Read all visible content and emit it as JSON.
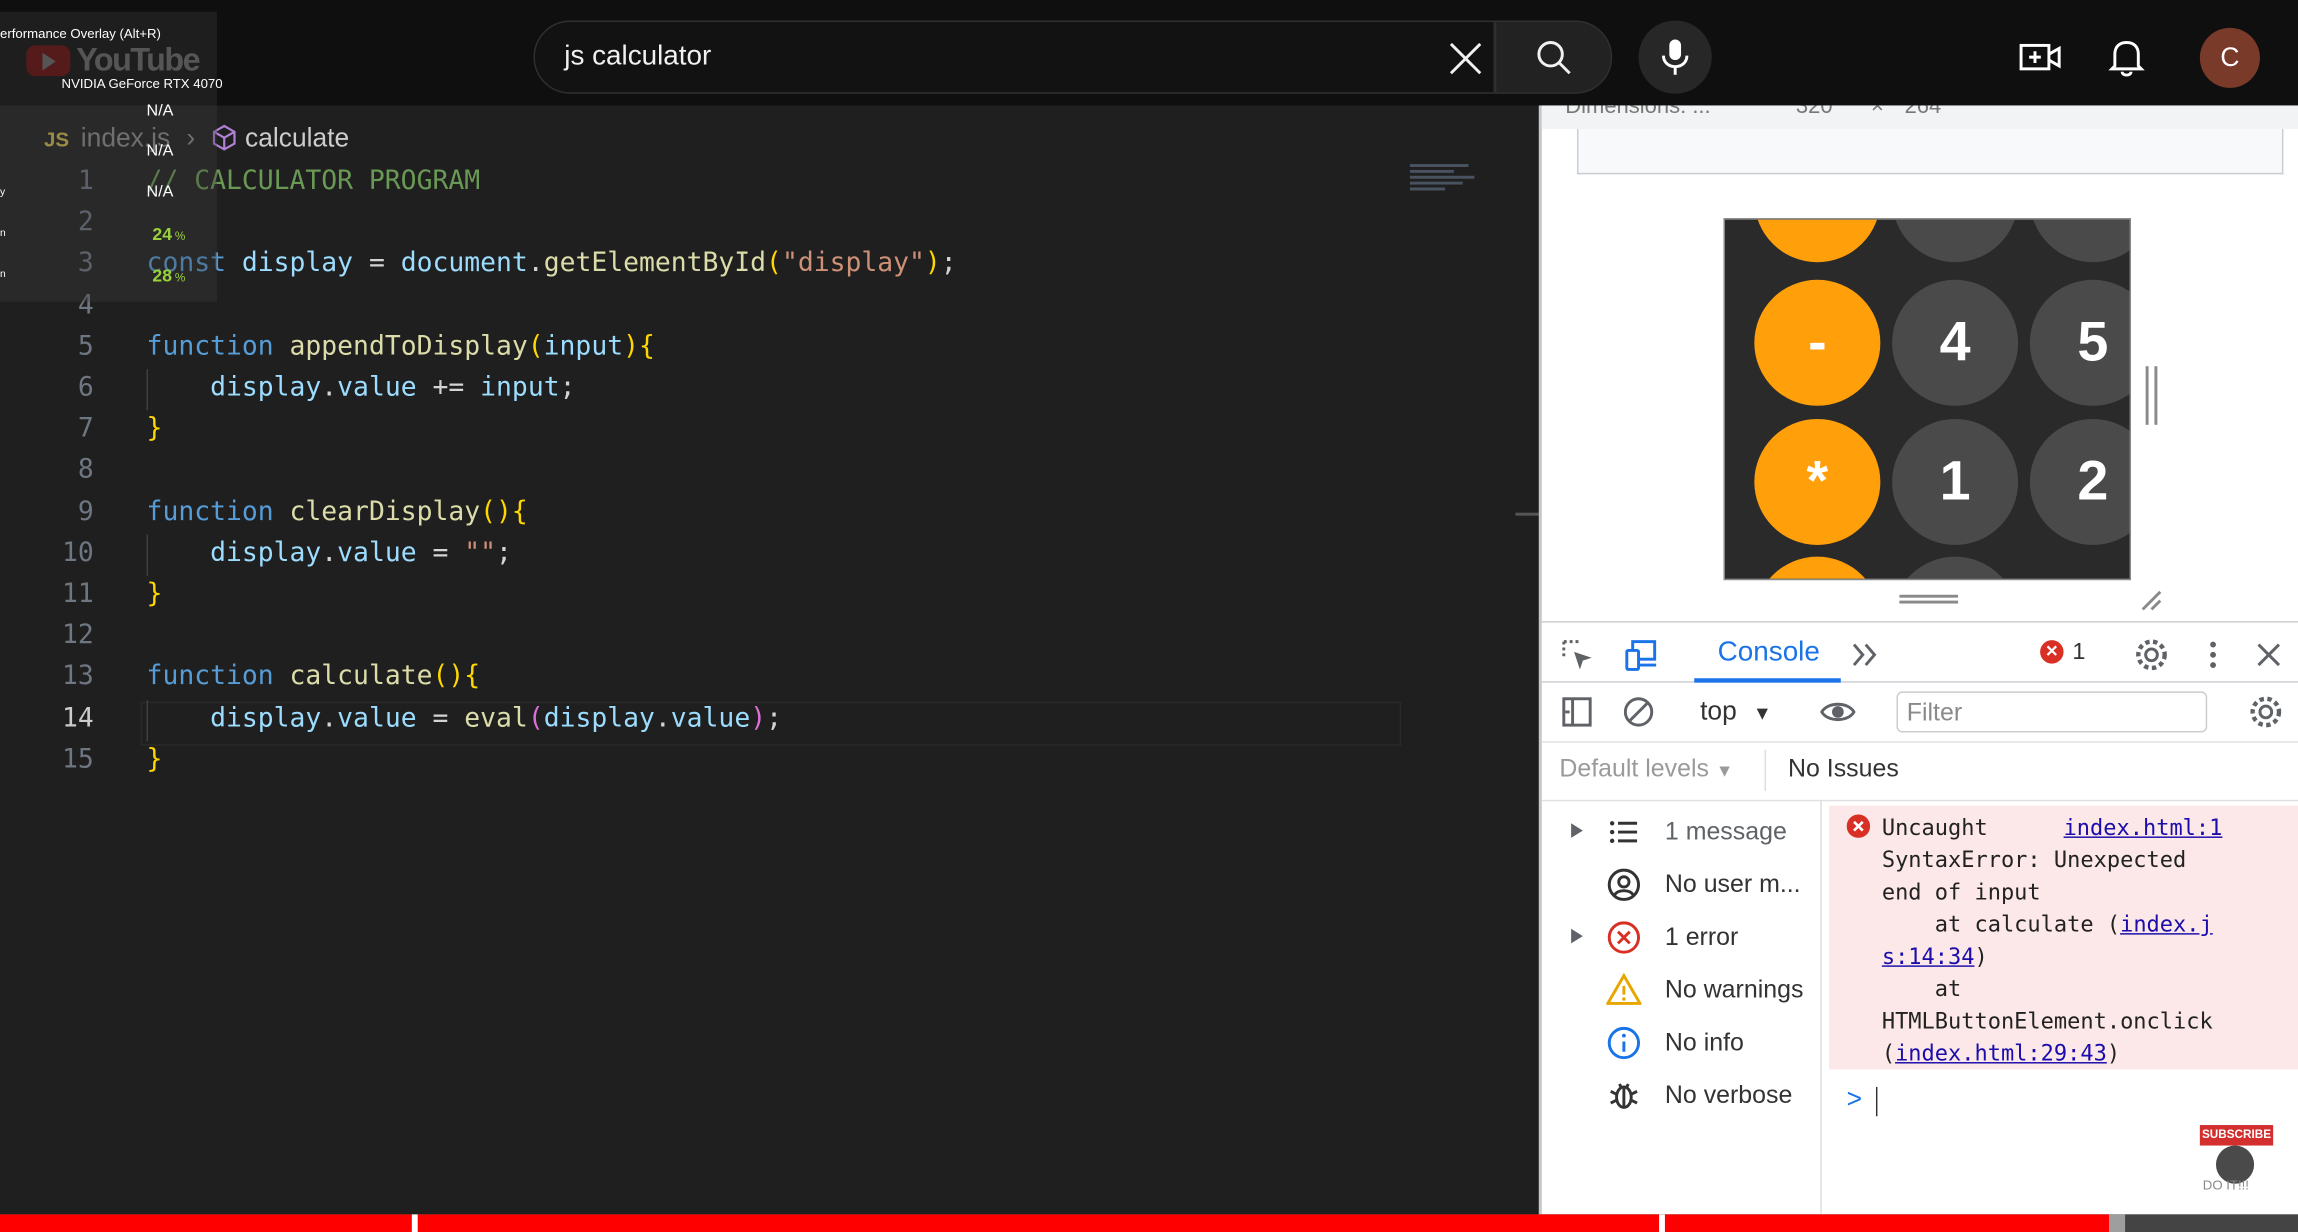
{
  "overlay": {
    "title": "erformance Overlay (Alt+R)",
    "gpu": "NVIDIA GeForce RTX 4070",
    "values": [
      "N/A",
      "N/A",
      "N/A"
    ],
    "percents": [
      "24",
      "28"
    ],
    "unit": "%",
    "side": [
      "y",
      "n",
      "n"
    ]
  },
  "youtube": {
    "logo": "YouTube",
    "search_value": "js calculator",
    "avatar_letter": "C"
  },
  "editor": {
    "breadcrumb": {
      "lang": "JS",
      "file": "index.js",
      "symbol": "calculate"
    },
    "active_line": 14,
    "lines": [
      {
        "n": "1",
        "html": "<span class='cm'>// CALCULATOR PROGRAM</span>"
      },
      {
        "n": "2",
        "html": ""
      },
      {
        "n": "3",
        "html": "<span class='kw'>const</span> <span class='var'>display</span> <span class='pl'>=</span> <span class='var'>document</span><span class='pl'>.</span><span class='fn'>getElementById</span><span class='br1'>(</span><span class='str'>\"display\"</span><span class='br1'>)</span><span class='pl'>;</span>"
      },
      {
        "n": "4",
        "html": ""
      },
      {
        "n": "5",
        "html": "<span class='kw'>function</span> <span class='fn'>appendToDisplay</span><span class='br1'>(</span><span class='var'>input</span><span class='br1'>){</span>"
      },
      {
        "n": "6",
        "html": "    <span class='var'>display</span><span class='pl'>.</span><span class='var'>value</span> <span class='pl'>+=</span> <span class='var'>input</span><span class='pl'>;</span>"
      },
      {
        "n": "7",
        "html": "<span class='br1'>}</span>"
      },
      {
        "n": "8",
        "html": ""
      },
      {
        "n": "9",
        "html": "<span class='kw'>function</span> <span class='fn'>clearDisplay</span><span class='br1'>(){</span>"
      },
      {
        "n": "10",
        "html": "    <span class='var'>display</span><span class='pl'>.</span><span class='var'>value</span> <span class='pl'>=</span> <span class='str'>\"\"</span><span class='pl'>;</span>"
      },
      {
        "n": "11",
        "html": "<span class='br1'>}</span>"
      },
      {
        "n": "12",
        "html": ""
      },
      {
        "n": "13",
        "html": "<span class='kw'>function</span> <span class='fn'>calculate</span><span class='br1'>(){</span>"
      },
      {
        "n": "14",
        "html": "    <span class='var'>display</span><span class='pl'>.</span><span class='var'>value</span> <span class='pl'>=</span> <span class='fn'>eval</span><span class='br2'>(</span><span class='var'>display</span><span class='pl'>.</span><span class='var'>value</span><span class='br2'>)</span><span class='pl'>;</span>"
      },
      {
        "n": "15",
        "html": "<span class='br1'>}</span>"
      }
    ]
  },
  "devtools": {
    "dimensions_label": "Dimensions: ...",
    "dimensions_w": "320",
    "dimensions_x": "×",
    "dimensions_h": "264",
    "calculator_buttons": [
      "-",
      "4",
      "5",
      "*",
      "1",
      "2"
    ],
    "console_tab": "Console",
    "error_count": "1",
    "context": "top",
    "filter_placeholder": "Filter",
    "levels": "Default levels",
    "issues": "No Issues",
    "sidebar": [
      {
        "label": "1 message",
        "icon": "list-icon",
        "expandable": true
      },
      {
        "label": "No user m...",
        "icon": "user-icon",
        "expandable": false
      },
      {
        "label": "1 error",
        "icon": "error-icon",
        "expandable": true
      },
      {
        "label": "No warnings",
        "icon": "warning-icon",
        "expandable": false
      },
      {
        "label": "No info",
        "icon": "info-icon",
        "expandable": false
      },
      {
        "label": "No verbose",
        "icon": "bug-icon",
        "expandable": false
      }
    ],
    "error": {
      "title": "Uncaught",
      "link1": "index.html:1",
      "line2": "SyntaxError: Unexpected",
      "line3": "end of input",
      "line4_pre": "    at calculate (",
      "link2a": "index.j",
      "link2b": "s:14:34",
      "line5_post": ")",
      "line6": "    at",
      "line7": "HTMLButtonElement.onclick",
      "line8_pre": "(",
      "link3": "index.html:29:43",
      "line8_post": ")"
    },
    "prompt": ">"
  },
  "subscribe": {
    "badge": "SUBSCRIBE",
    "channel": "DO IT!!!"
  },
  "video_progress": {
    "played_pct": 91.8,
    "buffered_pct": 92.5
  }
}
